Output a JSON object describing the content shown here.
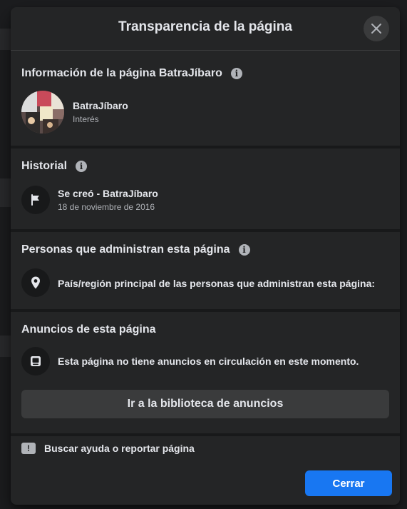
{
  "dialog": {
    "title": "Transparencia de la página",
    "close_icon": "close-icon"
  },
  "page_info": {
    "title": "Información de la página BatraJíbaro",
    "page_name": "BatraJíbaro",
    "category": "Interés"
  },
  "history": {
    "title": "Historial",
    "event": "Se creó - BatraJíbaro",
    "date": "18 de noviembre de 2016",
    "icon": "flag-icon"
  },
  "admins": {
    "title": "Personas que administran esta página",
    "country_label": "País/región principal de las personas que administran esta página:",
    "icon": "location-pin-icon"
  },
  "ads": {
    "title": "Anuncios de esta página",
    "status": "Esta página no tiene anuncios en circulación en este momento.",
    "library_button": "Ir a la biblioteca de anuncios",
    "icon": "ad-screen-icon"
  },
  "footer": {
    "help_label": "Buscar ayuda o reportar página",
    "close_button": "Cerrar"
  },
  "colors": {
    "modal_bg": "#242526",
    "accent": "#1877f2",
    "secondary_button": "#3a3b3c"
  }
}
